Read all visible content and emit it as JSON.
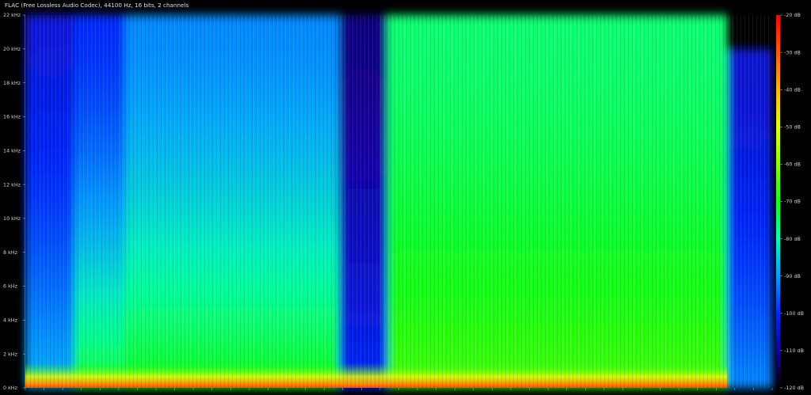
{
  "header": {
    "title": "FLAC (Free Lossless Audio Codec), 44100 Hz, 16 bits, 2 channels"
  },
  "chart_data": {
    "type": "heatmap",
    "title": "FLAC (Free Lossless Audio Codec), 44100 Hz, 16 bits, 2 channels",
    "xlabel": "",
    "ylabel": "",
    "ylim": [
      0,
      22
    ],
    "y_unit": "kHz",
    "y_ticks": [
      {
        "value": 0,
        "label": "0 kHz"
      },
      {
        "value": 2,
        "label": "2 kHz"
      },
      {
        "value": 4,
        "label": "4 kHz"
      },
      {
        "value": 6,
        "label": "6 kHz"
      },
      {
        "value": 8,
        "label": "8 kHz"
      },
      {
        "value": 10,
        "label": "10 kHz"
      },
      {
        "value": 12,
        "label": "12 kHz"
      },
      {
        "value": 14,
        "label": "14 kHz"
      },
      {
        "value": 16,
        "label": "16 kHz"
      },
      {
        "value": 18,
        "label": "18 kHz"
      },
      {
        "value": 20,
        "label": "20 kHz"
      },
      {
        "value": 22,
        "label": "22 kHz"
      }
    ],
    "colorbar": {
      "range_db": [
        -120,
        -20
      ],
      "ticks": [
        {
          "value": -20,
          "label": "-20 dB"
        },
        {
          "value": -30,
          "label": "-30 dB"
        },
        {
          "value": -40,
          "label": "-40 dB"
        },
        {
          "value": -50,
          "label": "-50 dB"
        },
        {
          "value": -60,
          "label": "-60 dB"
        },
        {
          "value": -70,
          "label": "-70 dB"
        },
        {
          "value": -80,
          "label": "-80 dB"
        },
        {
          "value": -90,
          "label": "-90 dB"
        },
        {
          "value": -100,
          "label": "-100 dB"
        },
        {
          "value": -110,
          "label": "-110 dB"
        },
        {
          "value": -120,
          "label": "-120 dB"
        }
      ],
      "stops": [
        {
          "db": -20,
          "color": "#ff0000"
        },
        {
          "db": -30,
          "color": "#ff5a00"
        },
        {
          "db": -40,
          "color": "#ffb400"
        },
        {
          "db": -50,
          "color": "#e6ff00"
        },
        {
          "db": -60,
          "color": "#8cff00"
        },
        {
          "db": -70,
          "color": "#14ff14"
        },
        {
          "db": -80,
          "color": "#00ffb4"
        },
        {
          "db": -90,
          "color": "#00a0ff"
        },
        {
          "db": -100,
          "color": "#0028ff"
        },
        {
          "db": -110,
          "color": "#1400a0"
        },
        {
          "db": -120,
          "color": "#000000"
        }
      ]
    },
    "sections": [
      {
        "t0": 0.0,
        "t1": 0.065,
        "high_db": -104,
        "low_db": -88,
        "cutoff_khz": 22
      },
      {
        "t0": 0.065,
        "t1": 0.133,
        "high_db": -100,
        "low_db": -72,
        "cutoff_khz": 22
      },
      {
        "t0": 0.133,
        "t1": 0.42,
        "high_db": -92,
        "low_db": -70,
        "cutoff_khz": 22
      },
      {
        "t0": 0.42,
        "t1": 0.485,
        "high_db": -112,
        "low_db": -100,
        "cutoff_khz": 22
      },
      {
        "t0": 0.485,
        "t1": 0.94,
        "high_db": -76,
        "low_db": -66,
        "cutoff_khz": 22
      },
      {
        "t0": 0.94,
        "t1": 1.0,
        "high_db": -105,
        "low_db": -92,
        "cutoff_khz": 20
      }
    ]
  }
}
